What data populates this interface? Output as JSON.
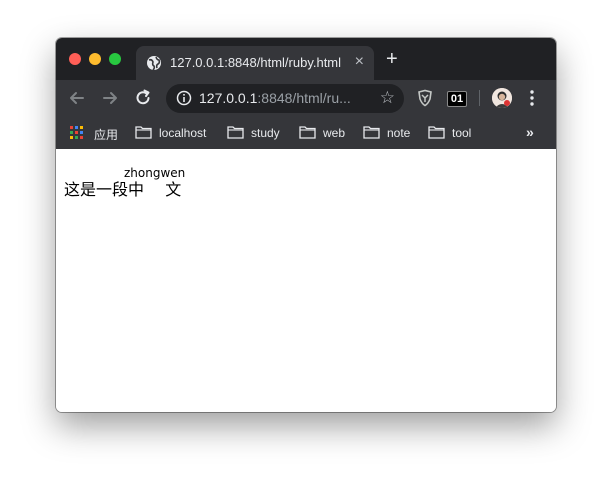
{
  "tab": {
    "title": "127.0.0.1:8848/html/ruby.html",
    "close_glyph": "×"
  },
  "new_tab_glyph": "+",
  "address_bar": {
    "host": "127.0.0.1",
    "rest": ":8848/html/ru..."
  },
  "toolbar": {
    "star_glyph": "☆",
    "extension_badge": "01"
  },
  "bookmarks": {
    "items": [
      {
        "label": "应用",
        "icon": "apps-grid-icon"
      },
      {
        "label": "localhost",
        "icon": "folder-icon"
      },
      {
        "label": "study",
        "icon": "folder-icon"
      },
      {
        "label": "web",
        "icon": "folder-icon"
      },
      {
        "label": "note",
        "icon": "folder-icon"
      },
      {
        "label": "tool",
        "icon": "folder-icon"
      }
    ],
    "overflow_glyph": "»"
  },
  "page": {
    "text_before": "这是一段",
    "ruby_base": "中 文",
    "ruby_annotation": "zhongwen"
  },
  "colors": {
    "tab_strip": "#202124",
    "toolbar": "#35363a",
    "omnibox": "#202124",
    "close_light": "#ff5f57",
    "min_light": "#febc2e",
    "max_light": "#28c840"
  }
}
